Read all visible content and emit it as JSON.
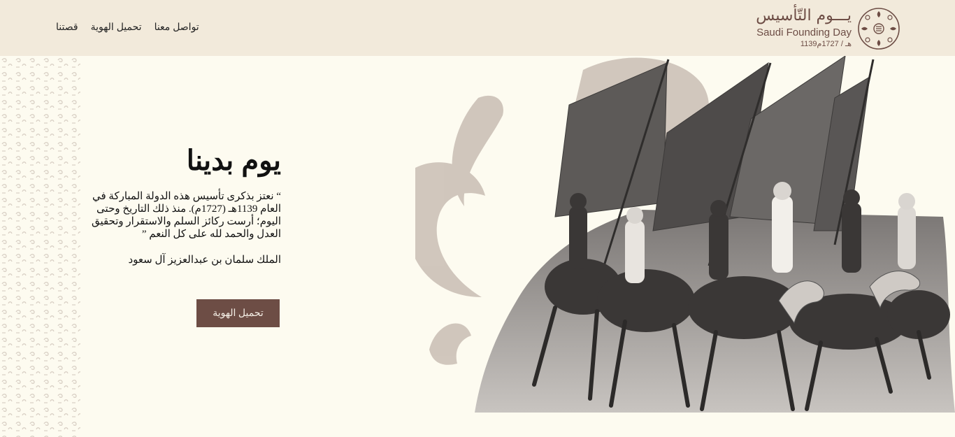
{
  "header": {
    "nav": [
      {
        "label": "قصتنا"
      },
      {
        "label": "تحميل الهوية"
      },
      {
        "label": "تواصل معنا"
      }
    ],
    "logo": {
      "title_ar": "يـــوم التّأسيس",
      "title_en": "Saudi Founding Day",
      "dates": "1139هـ / 1727م"
    }
  },
  "hero": {
    "title": "يوم بدينا",
    "quote": "“ نعتز بذكرى تأسيس هذه الدولة المباركة في العام 1139هـ (1727م). منذ ذلك التاريخ وحتى اليوم؛ أرست ركائز السلم والاستقرار وتحقيق العدل والحمد لله على كل النعم ”",
    "author": "الملك سلمان بن عبدالعزيز آل سعود",
    "cta_label": "تحميل الهوية",
    "image_alt": "historical photo of riders on camels carrying flags"
  },
  "colors": {
    "page_bg": "#fdfbf0",
    "header_bg": "#f2eadb",
    "brand_brown": "#6d4d45",
    "pattern": "#d8cfc4",
    "watermark": "#c9bdb4"
  }
}
